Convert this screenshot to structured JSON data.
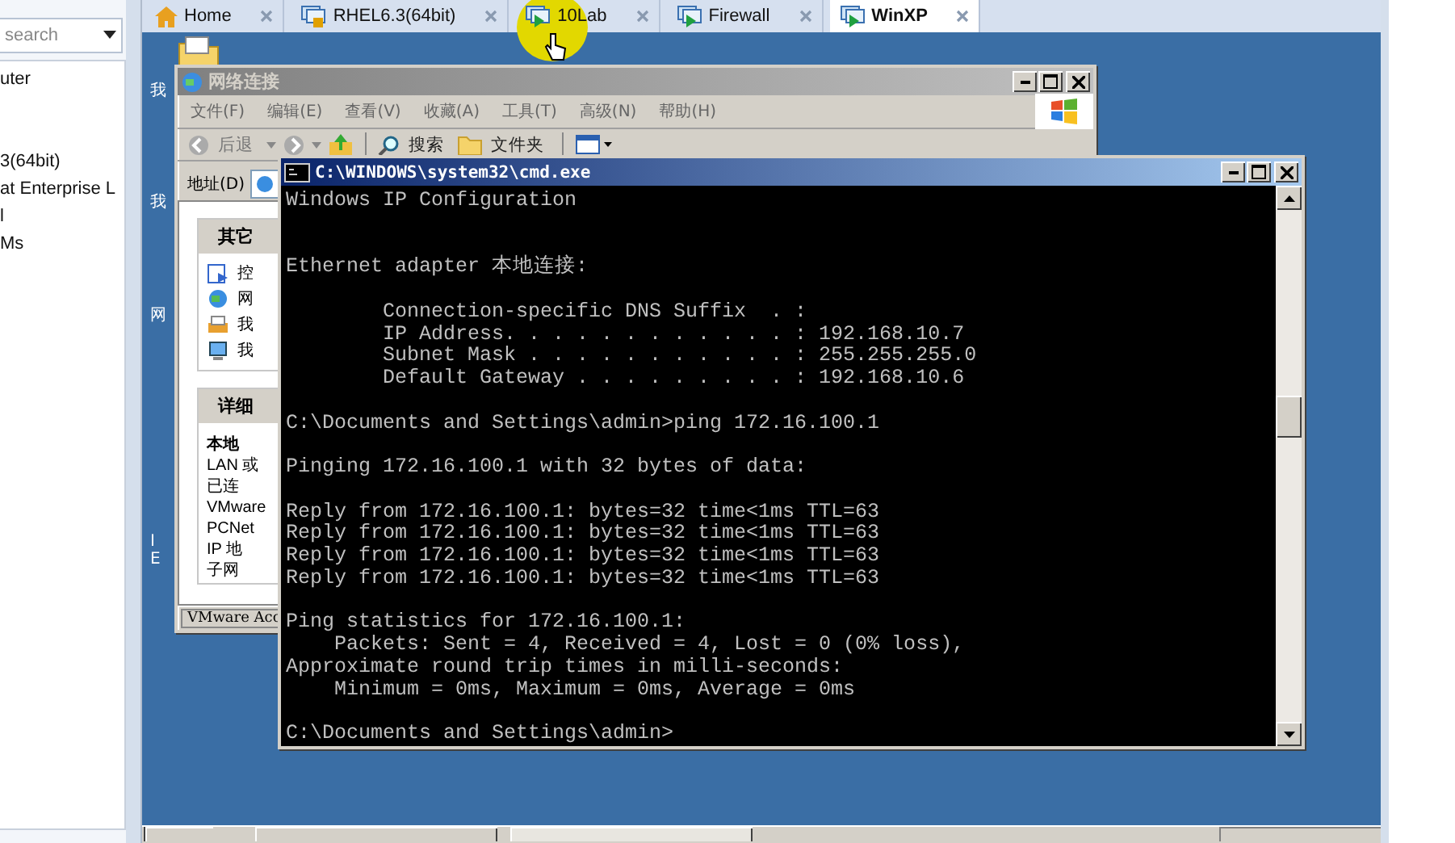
{
  "sidebar": {
    "search": {
      "placeholder": "search"
    },
    "items": [
      {
        "text": "uter"
      },
      {
        "text": "3(64bit)"
      },
      {
        "text": "at Enterprise L"
      },
      {
        "text": "l"
      },
      {
        "text": "Ms"
      }
    ]
  },
  "tabs": [
    {
      "label": "Home",
      "selected": false
    },
    {
      "label": "RHEL6.3(64bit)",
      "selected": false
    },
    {
      "label": "10Lab",
      "selected": false
    },
    {
      "label": "Firewall",
      "selected": false
    },
    {
      "label": "WinXP",
      "selected": true
    }
  ],
  "desktop": {
    "icon_labels": [
      {
        "text": "我"
      },
      {
        "text": "我"
      },
      {
        "text": "网"
      },
      {
        "text": "I"
      },
      {
        "text": "E"
      }
    ]
  },
  "explorer": {
    "title": "网络连接",
    "active": false,
    "menu": [
      "文件(F)",
      "编辑(E)",
      "查看(V)",
      "收藏(A)",
      "工具(T)",
      "高级(N)",
      "帮助(H)"
    ],
    "toolbar": {
      "back": "后退",
      "search": "搜索",
      "folders": "文件夹"
    },
    "address_label": "地址(D)",
    "panels": [
      {
        "title": "其它",
        "kind": "links",
        "items": [
          {
            "text": "控"
          },
          {
            "text": "网"
          },
          {
            "text": "我"
          },
          {
            "text": "我"
          }
        ]
      },
      {
        "title": "详细",
        "kind": "details",
        "items": [
          {
            "text": "本地",
            "bold": true
          },
          {
            "text": "LAN 或",
            "bold": false
          },
          {
            "text": "已连",
            "bold": false
          },
          {
            "text": "VMware",
            "bold": false
          },
          {
            "text": "PCNet",
            "bold": false
          },
          {
            "text": "IP 地",
            "bold": false
          },
          {
            "text": "子网",
            "bold": false
          }
        ]
      }
    ],
    "status": "VMware Acc"
  },
  "cmd": {
    "title": "C:\\WINDOWS\\system32\\cmd.exe",
    "active": true,
    "lines": [
      {
        "kind": "text",
        "text": "Windows IP Configuration"
      },
      {
        "kind": "blank"
      },
      {
        "kind": "blank"
      },
      {
        "kind": "text",
        "text": "Ethernet adapter 本地连接:"
      },
      {
        "kind": "blank"
      },
      {
        "kind": "text",
        "text": "        Connection-specific DNS Suffix  . :"
      },
      {
        "kind": "text",
        "text": "        IP Address. . . . . . . . . . . . : 192.168.10.7"
      },
      {
        "kind": "text",
        "text": "        Subnet Mask . . . . . . . . . . . : 255.255.255.0"
      },
      {
        "kind": "text",
        "text": "        Default Gateway . . . . . . . . . : 192.168.10.6"
      },
      {
        "kind": "blank"
      },
      {
        "kind": "text",
        "text": "C:\\Documents and Settings\\admin>ping 172.16.100.1"
      },
      {
        "kind": "blank"
      },
      {
        "kind": "text",
        "text": "Pinging 172.16.100.1 with 32 bytes of data:"
      },
      {
        "kind": "blank"
      },
      {
        "kind": "text",
        "text": "Reply from 172.16.100.1: bytes=32 time<1ms TTL=63"
      },
      {
        "kind": "text",
        "text": "Reply from 172.16.100.1: bytes=32 time<1ms TTL=63"
      },
      {
        "kind": "text",
        "text": "Reply from 172.16.100.1: bytes=32 time<1ms TTL=63"
      },
      {
        "kind": "text",
        "text": "Reply from 172.16.100.1: bytes=32 time<1ms TTL=63"
      },
      {
        "kind": "blank"
      },
      {
        "kind": "text",
        "text": "Ping statistics for 172.16.100.1:"
      },
      {
        "kind": "text",
        "text": "    Packets: Sent = 4, Received = 4, Lost = 0 (0% loss),"
      },
      {
        "kind": "text",
        "text": "Approximate round trip times in milli-seconds:"
      },
      {
        "kind": "text",
        "text": "    Minimum = 0ms, Maximum = 0ms, Average = 0ms"
      },
      {
        "kind": "blank"
      },
      {
        "kind": "text",
        "text": "C:\\Documents and Settings\\admin>"
      }
    ]
  }
}
